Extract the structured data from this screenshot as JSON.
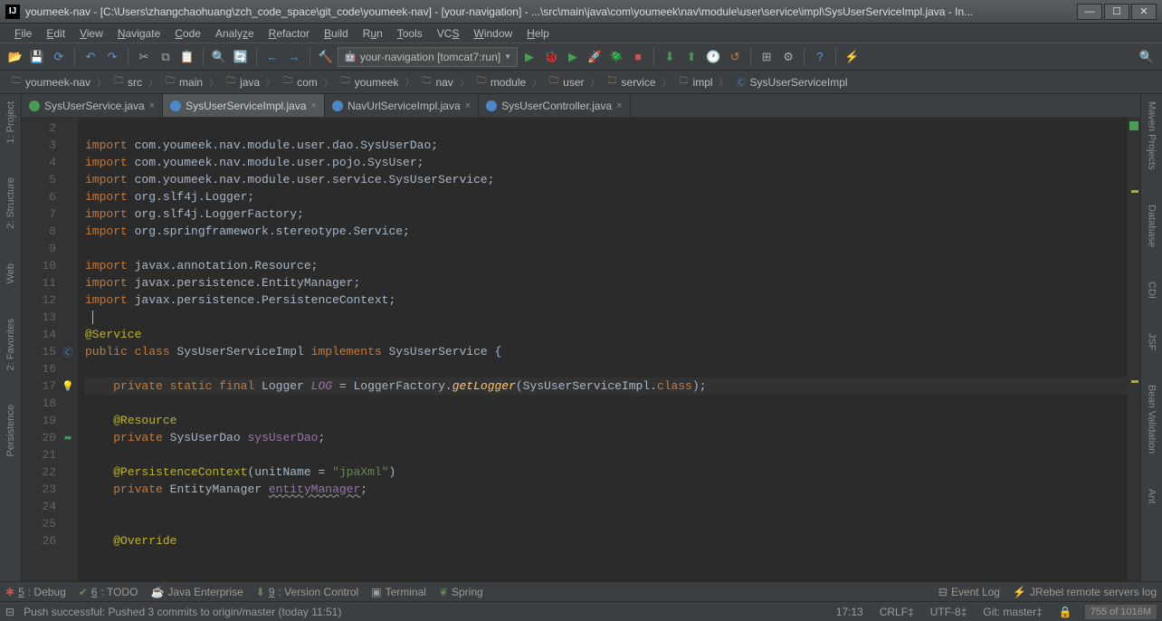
{
  "title": "youmeek-nav - [C:\\Users\\zhangchaohuang\\zch_code_space\\git_code\\youmeek-nav] - [your-navigation] - ...\\src\\main\\java\\com\\youmeek\\nav\\module\\user\\service\\impl\\SysUserServiceImpl.java - In...",
  "app_icon": "IJ",
  "menu": [
    "File",
    "Edit",
    "View",
    "Navigate",
    "Code",
    "Analyze",
    "Refactor",
    "Build",
    "Run",
    "Tools",
    "VCS",
    "Window",
    "Help"
  ],
  "run_config": {
    "label": "your-navigation [tomcat7:run]"
  },
  "breadcrumb": [
    "youmeek-nav",
    "src",
    "main",
    "java",
    "com",
    "youmeek",
    "nav",
    "module",
    "user",
    "service",
    "impl",
    "SysUserServiceImpl"
  ],
  "tabs": [
    {
      "label": "SysUserService.java",
      "icon": "interface",
      "active": false
    },
    {
      "label": "SysUserServiceImpl.java",
      "icon": "class",
      "active": true
    },
    {
      "label": "NavUrlServiceImpl.java",
      "icon": "class",
      "active": false
    },
    {
      "label": "SysUserController.java",
      "icon": "class",
      "active": false
    }
  ],
  "left_tools": [
    "1: Project",
    "2: Structure",
    "Web",
    "2: Favorites",
    "Persistence"
  ],
  "right_tools": [
    "Maven Projects",
    "Database",
    "CDI",
    "JSF",
    "Bean Validation",
    "Ant"
  ],
  "line_start": 2,
  "line_end": 26,
  "code": {
    "l3": {
      "kw": "import",
      "rest": " com.youmeek.nav.module.user.dao.SysUserDao;"
    },
    "l4": {
      "kw": "import",
      "rest": " com.youmeek.nav.module.user.pojo.SysUser;"
    },
    "l5": {
      "kw": "import",
      "rest": " com.youmeek.nav.module.user.service.SysUserService;"
    },
    "l6": {
      "kw": "import",
      "rest": " org.slf4j.Logger;"
    },
    "l7": {
      "kw": "import",
      "rest": " org.slf4j.LoggerFactory;"
    },
    "l8": {
      "kw": "import",
      "rest": " org.springframework.stereotype.Service;"
    },
    "l10": {
      "kw": "import",
      "rest": " javax.annotation.Resource;"
    },
    "l11": {
      "kw": "import",
      "rest": " javax.persistence.EntityManager;"
    },
    "l12": {
      "kw": "import",
      "rest": " javax.persistence.PersistenceContext;"
    },
    "l14": {
      "ann": "@Service"
    },
    "l15": {
      "kw1": "public class ",
      "cls": "SysUserServiceImpl ",
      "kw2": "implements ",
      "if": "SysUserService {"
    },
    "l17": {
      "kw": "private static final ",
      "type": "Logger ",
      "field": "LOG",
      "eq": " = LoggerFactory.",
      "mtd": "getLogger",
      "args": "(SysUserServiceImpl.",
      "cls": "class",
      "end": ");"
    },
    "l19": {
      "ann": "@Resource"
    },
    "l20": {
      "kw": "private ",
      "type": "SysUserDao ",
      "field": "sysUserDao",
      ";": ";"
    },
    "l22": {
      "ann": "@PersistenceContext",
      "paren": "(unitName = ",
      "str": "\"jpaXml\"",
      "close": ")"
    },
    "l23": {
      "kw": "private ",
      "type": "EntityManager ",
      "field": "entityManager",
      ";": ";"
    },
    "l26": {
      "ann": "@Override"
    }
  },
  "bottom_tools": [
    {
      "num": "5",
      "label": ": Debug"
    },
    {
      "num": "6",
      "label": ": TODO"
    },
    {
      "num": "",
      "label": "Java Enterprise"
    },
    {
      "num": "9",
      "label": ": Version Control"
    },
    {
      "num": "",
      "label": "Terminal"
    },
    {
      "num": "",
      "label": "Spring"
    }
  ],
  "bottom_right": [
    "Event Log",
    "JRebel remote servers log"
  ],
  "status": {
    "msg": "Push successful: Pushed 3 commits to origin/master (today 11:51)",
    "pos": "17:13",
    "eol": "CRLF‡",
    "enc": "UTF-8‡",
    "git": "Git: master‡",
    "mem": "755 of 1016M"
  }
}
